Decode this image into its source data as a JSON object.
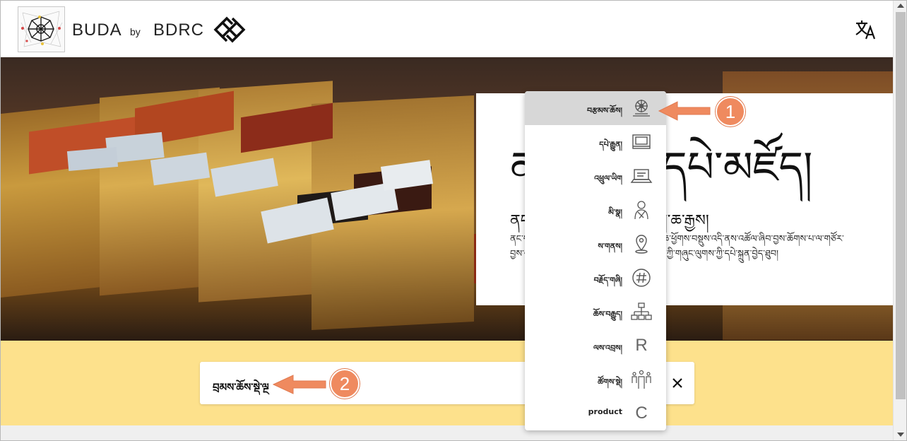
{
  "header": {
    "brand_name": "BUDA",
    "brand_by": "by",
    "brand_org": "BDRC",
    "language_icon": "translate-icon"
  },
  "hero": {
    "title": "ནང་བསྟན་དཔེ་མཛོད།",
    "subtitle": "ནང་བསྟན་དཔེ་ཚོགས་དང་ཡིག་ཆ་རྒྱས།",
    "description": "ནང་བསྟན་གྱི་དཔེ་ཚོགས་དང་གཞུང་ལུགས་ཀྱི་ཡིག་ཆ་ཕྱོགས་བསྡུས་འདི་ནས་འཚོལ་ཞིབ་བྱས་ཆོགས་པ་ལ་གཙོར་བྱས་པའི་ཚོགས་པ་དང་མཉམ་དུ་ཉམས་ཞིབ་དང་ཆོས་ཀྱི་གཞུང་ལུགས་ཀྱི་དཔེ་སྐྲུན་བྱེད་ཐུབ།"
  },
  "search": {
    "value": "བྲམས་ཆོས་སྡེ་ལྔ",
    "clear_icon": "close-icon"
  },
  "dropdown": {
    "items": [
      {
        "label": "བརྩམས་ཆོས།",
        "icon": "dharma-wheel-icon",
        "active": true
      },
      {
        "label": "དཔེ་རྒྱུན།",
        "icon": "pecha-icon",
        "active": false
      },
      {
        "label": "འཕྲུལ་ཡིག",
        "icon": "laptop-icon",
        "active": false
      },
      {
        "label": "མི་སྣ།",
        "icon": "person-icon",
        "active": false
      },
      {
        "label": "ས་གནས།",
        "icon": "map-pin-icon",
        "active": false
      },
      {
        "label": "བརྗོད་གཞི།",
        "icon": "hashtag-icon",
        "active": false
      },
      {
        "label": "ཆོས་བརྒྱུད།",
        "icon": "lineage-tree-icon",
        "active": false
      },
      {
        "label": "ལས་འབྲས།",
        "icon": "r-letter-icon",
        "letter": "R",
        "active": false
      },
      {
        "label": "ཚོགས་སྡེ།",
        "icon": "corporation-icon",
        "active": false
      },
      {
        "label": "product",
        "icon": "c-letter-icon",
        "letter": "C",
        "active": false
      }
    ]
  },
  "annotations": {
    "badge_1": "1",
    "badge_2": "2",
    "color": "#ef8a5f"
  },
  "colors": {
    "search_band": "#fde18c",
    "active_item": "#d7d7d7"
  }
}
